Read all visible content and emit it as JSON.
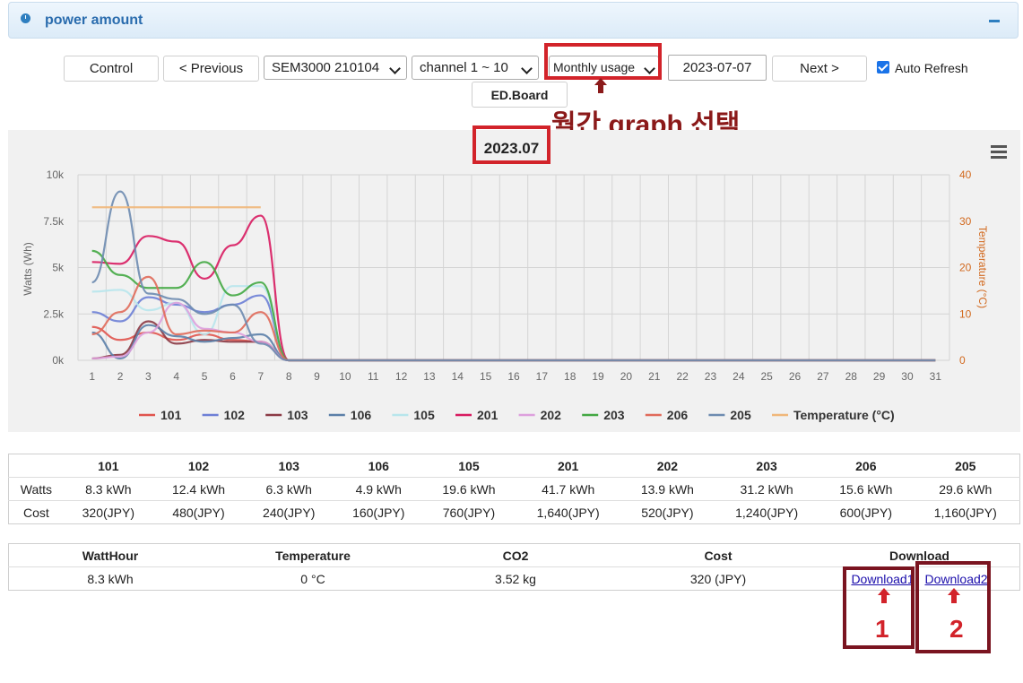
{
  "panel": {
    "title": "power amount"
  },
  "toolbar": {
    "control_label": "Control",
    "previous_label": "< Previous",
    "device_select": "SEM3000  210104",
    "channel_select": "channel 1 ~ 10",
    "period_select": "Monthly usage",
    "date_value": "2023-07-07",
    "next_label": "Next >",
    "auto_refresh_label": "Auto Refresh",
    "auto_refresh_checked": true,
    "edboard_label": "ED.Board"
  },
  "annotations": {
    "monthly_note": "월간 graph 선택",
    "marker_1": "1",
    "marker_2": "2"
  },
  "chart_data": {
    "type": "line",
    "title": "2023.07",
    "ylabel": "Watts (Wh)",
    "y2label": "Temperature (°C)",
    "ylim": [
      0,
      10000
    ],
    "y2lim": [
      0,
      40
    ],
    "y_ticks": [
      "0k",
      "2.5k",
      "5k",
      "7.5k",
      "10k"
    ],
    "y2_ticks": [
      "0",
      "10",
      "20",
      "30",
      "40"
    ],
    "x": [
      1,
      2,
      3,
      4,
      5,
      6,
      7,
      8,
      9,
      10,
      11,
      12,
      13,
      14,
      15,
      16,
      17,
      18,
      19,
      20,
      21,
      22,
      23,
      24,
      25,
      26,
      27,
      28,
      29,
      30,
      31
    ],
    "series": [
      {
        "name": "101",
        "color": "#e0544e",
        "values": [
          1800,
          1100,
          1500,
          1100,
          1400,
          1100,
          1000,
          0
        ]
      },
      {
        "name": "102",
        "color": "#6d7fd6",
        "values": [
          2600,
          2100,
          3400,
          3000,
          2600,
          3000,
          3500,
          0
        ]
      },
      {
        "name": "103",
        "color": "#8b3a45",
        "values": [
          100,
          300,
          2100,
          900,
          1100,
          1000,
          1000,
          0
        ]
      },
      {
        "name": "106",
        "color": "#5b7fa8",
        "values": [
          1500,
          100,
          1900,
          1300,
          1000,
          1200,
          1400,
          0
        ]
      },
      {
        "name": "105",
        "color": "#b8e6ec",
        "values": [
          3700,
          3800,
          2700,
          3100,
          1400,
          4000,
          4000,
          0
        ]
      },
      {
        "name": "201",
        "color": "#d81b60",
        "values": [
          5300,
          5200,
          6700,
          6400,
          4400,
          6200,
          7800,
          0
        ]
      },
      {
        "name": "202",
        "color": "#dda0dd",
        "values": [
          100,
          200,
          1500,
          3100,
          1700,
          1500,
          1000,
          0
        ]
      },
      {
        "name": "203",
        "color": "#43a843",
        "values": [
          5900,
          4600,
          3900,
          3900,
          5300,
          3500,
          4200,
          0
        ]
      },
      {
        "name": "206",
        "color": "#e06a5a",
        "values": [
          1400,
          2600,
          4500,
          1400,
          1600,
          1500,
          2600,
          0
        ]
      },
      {
        "name": "205",
        "color": "#6d8bb0",
        "values": [
          4200,
          9100,
          3600,
          3300,
          2500,
          3000,
          900,
          0
        ]
      },
      {
        "name": "Temperature (°C)",
        "color": "#f0b77a",
        "axis": "right",
        "values": [
          33,
          33,
          33,
          33,
          33,
          33,
          33
        ]
      }
    ]
  },
  "summary_table": {
    "headers": [
      "",
      "101",
      "102",
      "103",
      "106",
      "105",
      "201",
      "202",
      "203",
      "206",
      "205"
    ],
    "rows": [
      [
        "Watts",
        "8.3 kWh",
        "12.4 kWh",
        "6.3 kWh",
        "4.9 kWh",
        "19.6 kWh",
        "41.7 kWh",
        "13.9 kWh",
        "31.2 kWh",
        "15.6 kWh",
        "29.6 kWh"
      ],
      [
        "Cost",
        "320(JPY)",
        "480(JPY)",
        "240(JPY)",
        "160(JPY)",
        "760(JPY)",
        "1,640(JPY)",
        "520(JPY)",
        "1,240(JPY)",
        "600(JPY)",
        "1,160(JPY)"
      ]
    ]
  },
  "totals_table": {
    "headers": [
      "WattHour",
      "Temperature",
      "CO2",
      "Cost",
      "Download"
    ],
    "values": [
      "8.3 kWh",
      "0 °C",
      "3.52 kg",
      "320 (JPY)"
    ],
    "download1": "Download1",
    "download2": "Download2"
  }
}
